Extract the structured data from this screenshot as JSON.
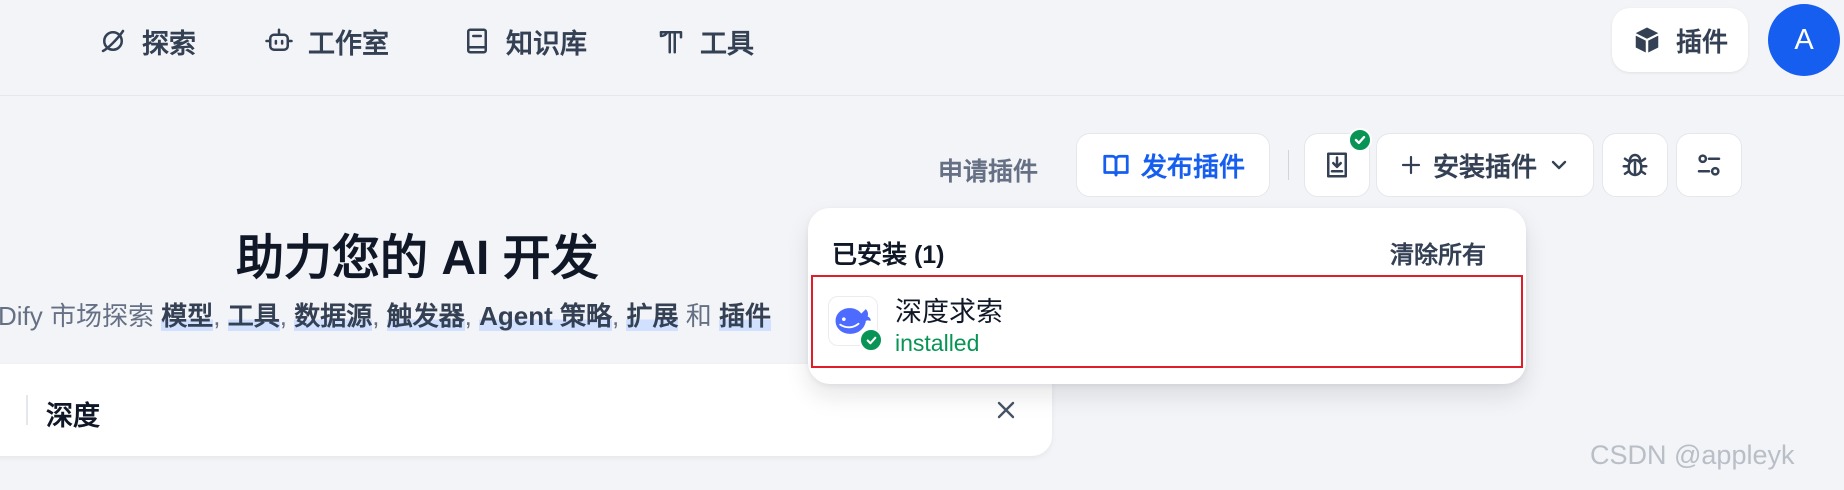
{
  "nav": {
    "items": [
      {
        "label": "探索",
        "icon": "planet-icon"
      },
      {
        "label": "工作室",
        "icon": "robot-icon"
      },
      {
        "label": "知识库",
        "icon": "book-icon"
      },
      {
        "label": "工具",
        "icon": "hammer-icon"
      }
    ],
    "plugins_label": "插件",
    "avatar_initial": "A"
  },
  "toolbar": {
    "apply_label": "申请插件",
    "publish_label": "发布插件",
    "install_label": "安装插件"
  },
  "hero": {
    "title": "助力您的 AI 开发",
    "subtitle_prefix": "Dify 市场探索",
    "models": "模型",
    "tools": "工具",
    "datasources": "数据源",
    "triggers": "触发器",
    "agent": "Agent 策略",
    "extensions": "扩展",
    "and": "和",
    "plugins_partial": "插件"
  },
  "search": {
    "value": "深度"
  },
  "dropdown": {
    "title": "已安装 (1)",
    "clear_label": "清除所有",
    "items": [
      {
        "name": "深度求索",
        "status": "installed"
      }
    ]
  },
  "watermark": "CSDN @appleyk",
  "colors": {
    "accent": "#155eef",
    "success": "#079455",
    "highlight_border": "#e11d2a"
  }
}
